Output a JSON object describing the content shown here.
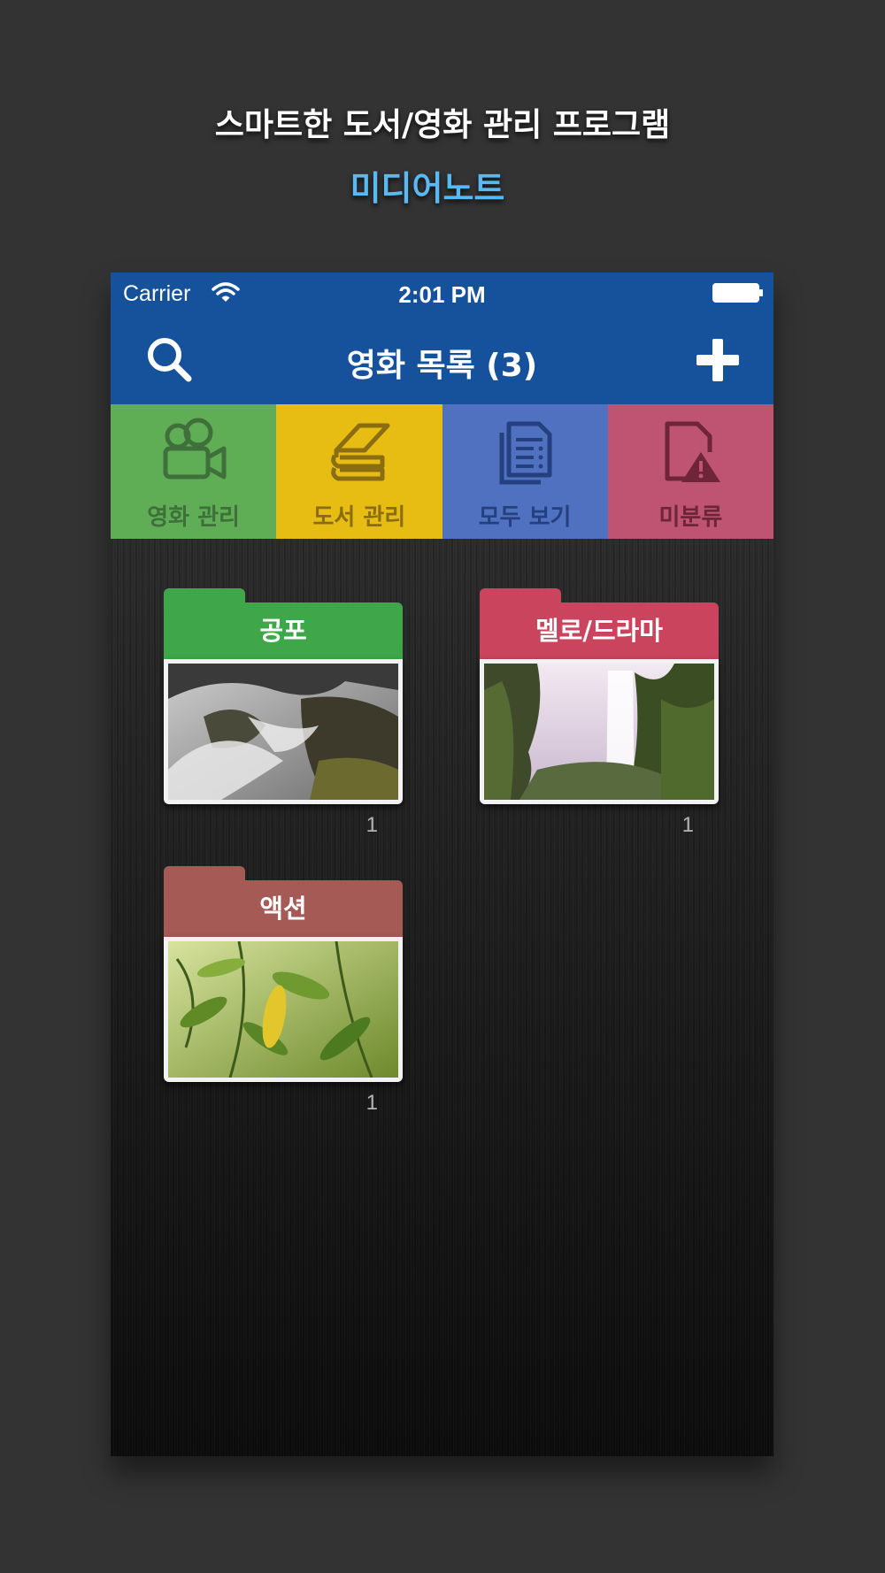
{
  "promo": {
    "title": "스마트한 도서/영화 관리 프로그램",
    "subtitle": "미디어노트"
  },
  "statusbar": {
    "carrier": "Carrier",
    "time": "2:01 PM",
    "icons": [
      "wifi-icon",
      "battery-icon"
    ]
  },
  "navbar": {
    "title": "영화 목록 (3)",
    "left_icon": "search-icon",
    "right_icon": "plus-icon"
  },
  "tabs": [
    {
      "label": "영화 관리",
      "icon": "movie-camera-icon",
      "color": "#5fae55",
      "text_color": "#3f6f3a"
    },
    {
      "label": "도서 관리",
      "icon": "books-icon",
      "color": "#e7bd14",
      "text_color": "#8a6d10"
    },
    {
      "label": "모두 보기",
      "icon": "document-list-icon",
      "color": "#4f71c0",
      "text_color": "#24407f"
    },
    {
      "label": "미분류",
      "icon": "file-warning-icon",
      "color": "#bf5372",
      "text_color": "#6e2539"
    }
  ],
  "folders": [
    {
      "name": "공포",
      "count": "1",
      "color": "#3fa64a",
      "image": "waterfall-rocks-image"
    },
    {
      "name": "멜로/드라마",
      "count": "1",
      "color": "#c9445c",
      "image": "waterfall-cliff-image"
    },
    {
      "name": "액션",
      "count": "1",
      "color": "#a65a55",
      "image": "green-leaves-image"
    }
  ]
}
